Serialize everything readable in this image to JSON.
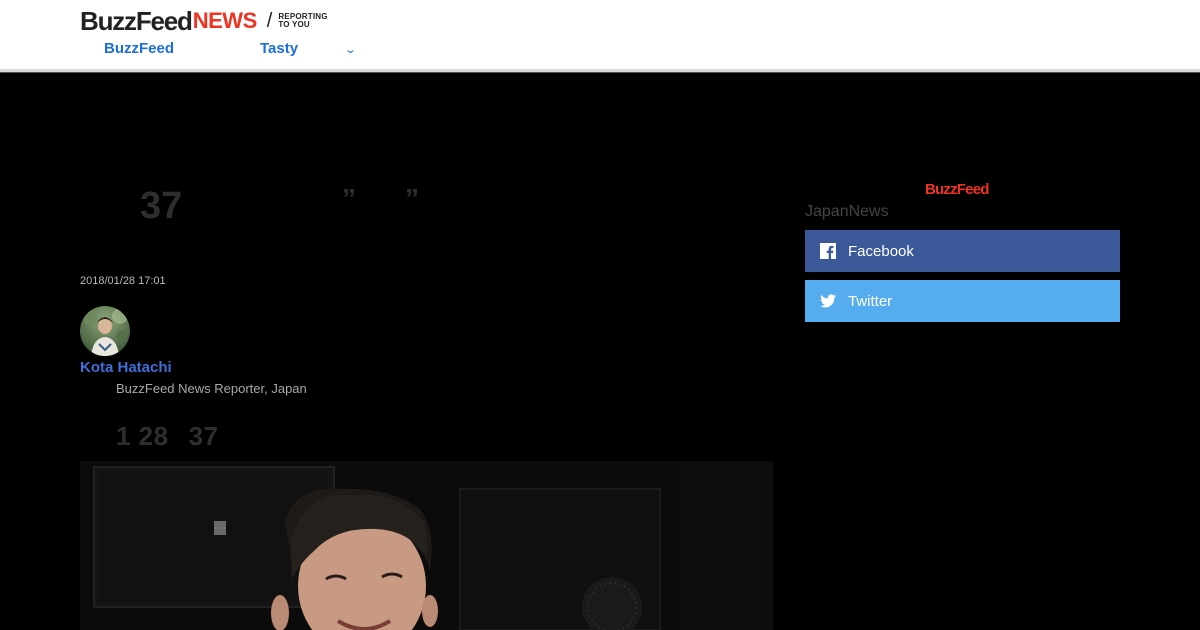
{
  "header": {
    "logo_buzzfeed": "BuzzFeed",
    "logo_news": "NEWS",
    "logo_slash": "/",
    "logo_tagline_line1": "REPORTING",
    "logo_tagline_line2": "TO YOU",
    "nav": {
      "buzzfeed_label": "BuzzFeed",
      "tasty_label": "Tasty",
      "more_icon": "chevron-down-icon"
    }
  },
  "article": {
    "title_number": "37",
    "quote_open": "”",
    "quote_close": "”",
    "timestamp": "2018/01/28 17:01",
    "author": {
      "name": "Kota Hatachi",
      "role": "BuzzFeed News Reporter, Japan"
    },
    "dateline": {
      "month_day": "1 28",
      "age": "37"
    }
  },
  "sidebar": {
    "logo": "BuzzFeed",
    "label": "JapanNews",
    "share": {
      "facebook_label": "Facebook",
      "facebook_icon": "facebook-icon",
      "twitter_label": "Twitter",
      "twitter_icon": "twitter-icon"
    }
  },
  "colors": {
    "facebook": "#3b5998",
    "twitter": "#55acee",
    "brand_red": "#ee3322",
    "link_blue": "#1c6fdb",
    "background": "#000000"
  }
}
